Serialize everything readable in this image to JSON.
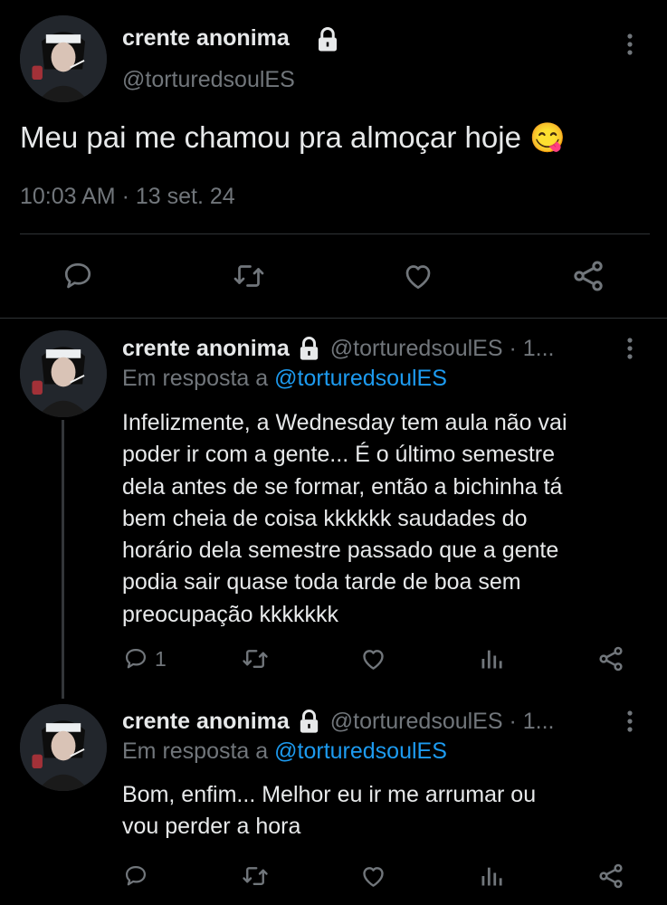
{
  "main_tweet": {
    "author_name": "crente anonima",
    "lock_icon": "lock-icon",
    "handle": "@torturedsoulES",
    "text": "Meu pai me chamou pra almoçar hoje",
    "emoji": "😋",
    "timestamp": "10:03 AM · 13 set. 24",
    "actions": [
      "reply-icon",
      "retweet-icon",
      "like-icon",
      "share-icon"
    ]
  },
  "replies": [
    {
      "author_name": "crente anonima",
      "handle_time": "@torturedsoulES · 1...",
      "reply_prefix": "Em resposta a",
      "reply_to": "@torturedsoulES",
      "text_lines": [
        "Infelizmente, a Wednesday tem aula não vai",
        "poder ir com a gente... É o último semestre",
        "dela antes de se formar, então a bichinha tá",
        "bem cheia de coisa kkkkkk saudades do",
        "horário dela semestre passado que a gente",
        "podia sair quase toda tarde de boa sem",
        "preocupação kkkkkkk"
      ],
      "reply_count": "1"
    },
    {
      "author_name": "crente anonima",
      "handle_time": "@torturedsoulES · 1...",
      "reply_prefix": "Em resposta a",
      "reply_to": "@torturedsoulES",
      "text_lines": [
        "Bom, enfim... Melhor eu ir me arrumar ou",
        "vou perder a hora"
      ],
      "reply_count": ""
    }
  ],
  "colors": {
    "background": "#000000",
    "text": "#e7e9ea",
    "secondary": "#71767b",
    "link": "#1d9bf0",
    "divider": "#2f3336"
  }
}
